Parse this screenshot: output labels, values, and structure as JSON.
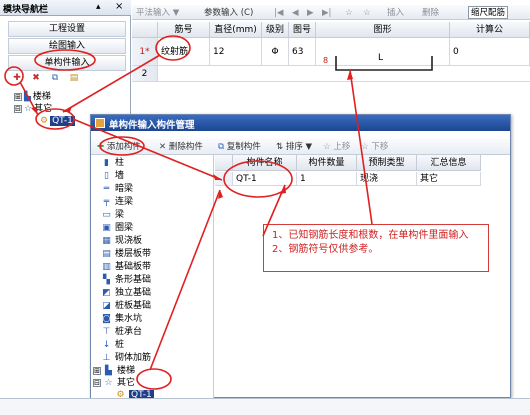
{
  "nav": {
    "title": "模块导航栏",
    "pin_icon": "pin-icon",
    "close_icon": "close-icon",
    "buttons": [
      "工程设置",
      "绘图输入",
      "单构件输入"
    ],
    "tools": [
      "add-icon",
      "delete-icon",
      "copy-icon",
      "paste-icon"
    ],
    "tree": [
      {
        "label": "楼梯",
        "expander": "⊞",
        "icon": "stairs-icon"
      },
      {
        "label": "其它",
        "expander": "⊟",
        "icon": "star-icon"
      },
      {
        "label": "QT-1",
        "icon": "gear-icon"
      }
    ]
  },
  "toolbar": {
    "items": [
      "平法输入 ▼",
      "参数输入 (C)",
      "|◀",
      "◀",
      "▶",
      "▶|",
      "☆",
      "☆",
      "插入",
      "删除",
      "缩尺配筋"
    ]
  },
  "grid": {
    "headers": [
      "筋号",
      "直径(mm)",
      "级别",
      "图号",
      "图形",
      "计算公"
    ],
    "rows": [
      {
        "num": "1*",
        "name": "纹射筋",
        "diameter": "12",
        "grade": "Φ",
        "shape_no": "63",
        "shape_left": "8",
        "shape_label": "L",
        "calc": "0"
      },
      {
        "num": "2"
      }
    ]
  },
  "dialog": {
    "title": "单构件输入构件管理",
    "toolbar": [
      "添加构件",
      "删除构件",
      "复制构件",
      "排序 ▼",
      "上移",
      "下移"
    ],
    "tree": [
      {
        "label": "柱",
        "icon": "column-icon"
      },
      {
        "label": "墙",
        "icon": "wall-icon"
      },
      {
        "label": "暗梁",
        "icon": "beam-icon"
      },
      {
        "label": "连梁",
        "icon": "beam-icon"
      },
      {
        "label": "梁",
        "icon": "beam-icon"
      },
      {
        "label": "圈梁",
        "icon": "beam-icon"
      },
      {
        "label": "现浇板",
        "icon": "slab-icon"
      },
      {
        "label": "楼层板带",
        "icon": "slab-icon"
      },
      {
        "label": "基础板带",
        "icon": "slab-icon"
      },
      {
        "label": "条形基础",
        "icon": "foundation-icon"
      },
      {
        "label": "独立基础",
        "icon": "foundation-icon"
      },
      {
        "label": "桩板基础",
        "icon": "foundation-icon"
      },
      {
        "label": "集水坑",
        "icon": "pit-icon"
      },
      {
        "label": "桩承台",
        "icon": "pile-cap-icon"
      },
      {
        "label": "桩",
        "icon": "pile-icon"
      },
      {
        "label": "砌体加筋",
        "icon": "masonry-icon"
      },
      {
        "label": "楼梯",
        "icon": "stairs-icon",
        "expander": "⊞"
      },
      {
        "label": "其它",
        "icon": "star-icon",
        "expander": "⊟"
      },
      {
        "label": "QT-1",
        "icon": "gear-icon"
      }
    ],
    "table": {
      "headers": [
        "构件名称",
        "构件数量",
        "预制类型",
        "汇总信息"
      ],
      "row": [
        "QT-1",
        "1",
        "现浇",
        "其它"
      ]
    }
  },
  "annotation": {
    "lines": [
      "1、已知钢筋长度和根数，在单构件里面输入",
      "2、钢筋符号仅供参考。"
    ],
    "color": "#d02020"
  }
}
